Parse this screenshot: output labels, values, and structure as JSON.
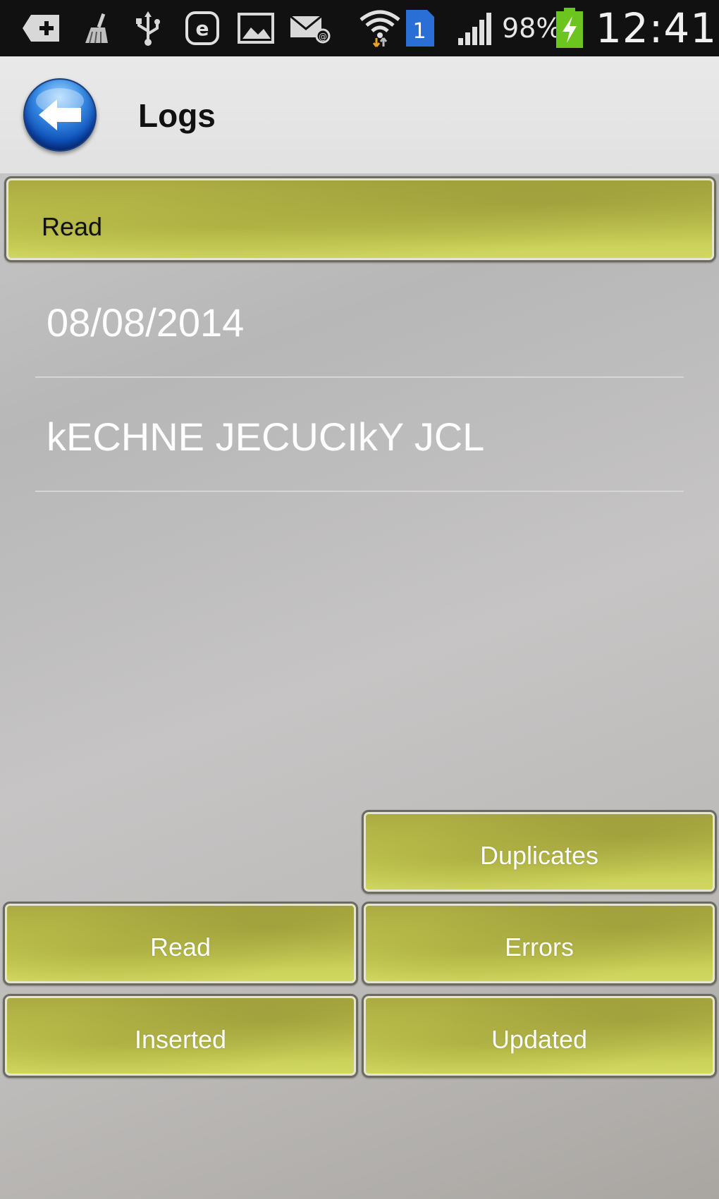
{
  "status_bar": {
    "icons": [
      "add-icon",
      "broom-icon",
      "usb-icon",
      "e-icon",
      "image-icon",
      "mail-icon",
      "wifi-icon",
      "sim-1-icon",
      "signal-icon",
      "battery-icon"
    ],
    "sim_label": "1",
    "battery_percent": "98%",
    "time": "12:41"
  },
  "action_bar": {
    "title": "Logs"
  },
  "section": {
    "label": "Read"
  },
  "list": {
    "items": [
      {
        "text": "08/08/2014"
      },
      {
        "text": "kECHNE JECUCIkY JCL"
      }
    ]
  },
  "buttons": {
    "duplicates": "Duplicates",
    "read": "Read",
    "errors": "Errors",
    "inserted": "Inserted",
    "updated": "Updated"
  },
  "colors": {
    "button_olive": "#c9cf58",
    "status_bar": "#111111",
    "back_button_blue": "#0d4fb8",
    "battery_green": "#6cc51e"
  }
}
